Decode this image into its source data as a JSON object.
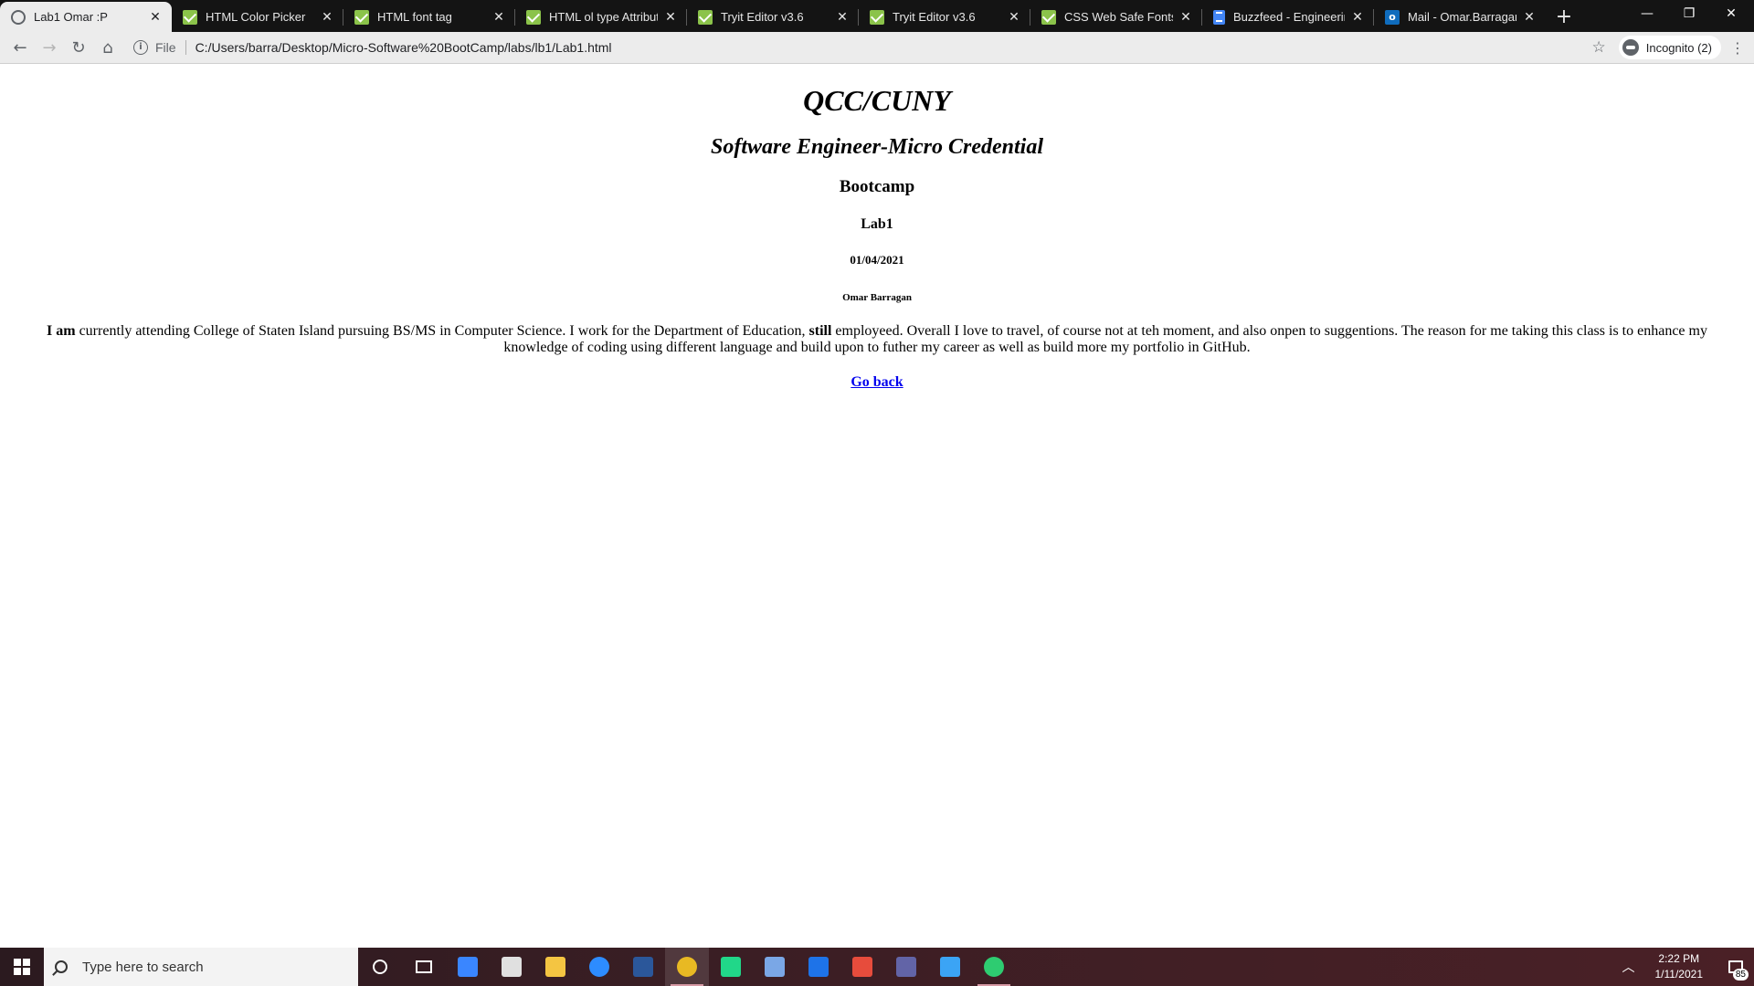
{
  "browser": {
    "tabs": [
      {
        "title": "Lab1 Omar :P",
        "icon": "globe-icon",
        "active": true
      },
      {
        "title": "HTML Color Picker",
        "icon": "w3schools-icon"
      },
      {
        "title": "HTML font tag",
        "icon": "w3schools-icon"
      },
      {
        "title": "HTML ol type Attribute",
        "icon": "w3schools-icon"
      },
      {
        "title": "Tryit Editor v3.6",
        "icon": "w3schools-icon"
      },
      {
        "title": "Tryit Editor v3.6",
        "icon": "w3schools-icon"
      },
      {
        "title": "CSS Web Safe Fonts",
        "icon": "w3schools-icon"
      },
      {
        "title": "Buzzfeed - Engineering",
        "icon": "google-docs-icon"
      },
      {
        "title": "Mail - Omar.Barragan@",
        "icon": "outlook-icon"
      }
    ],
    "new_tab": "+",
    "omnibox": {
      "scheme": "File",
      "url": "C:/Users/barra/Desktop/Micro-Software%20BootCamp/labs/lb1/Lab1.html"
    },
    "incognito_label": "Incognito (2)"
  },
  "page": {
    "h1": "QCC/CUNY",
    "h2": "Software Engineer-Micro Credential",
    "h3": "Bootcamp",
    "h4": "Lab1",
    "h5": "01/04/2021",
    "h6": "Omar Barragan",
    "paragraph": {
      "bold_start": "I am",
      "text_1": " currently attending College of Staten Island pursuing BS/MS in Computer Science. I work for the Department of Education, ",
      "bold_mid": "still",
      "text_2": " employeed. Overall I love to travel, of course not at teh moment, and also onpen to suggentions. The reason for me taking this class is to enhance my knowledge of coding using different language and build upon to futher my career as well as build more my portfolio in GitHub."
    },
    "back_link": "Go back"
  },
  "taskbar": {
    "search_placeholder": "Type here to search",
    "time": "2:22 PM",
    "date": "1/11/2021",
    "notification_count": "85",
    "pinned": [
      {
        "name": "calendar-icon",
        "color": "#3a86ff"
      },
      {
        "name": "store-icon",
        "color": "#e0e0e0"
      },
      {
        "name": "file-explorer-icon",
        "color": "#f4c542"
      },
      {
        "name": "zoom-icon",
        "color": "#2d8cff"
      },
      {
        "name": "word-icon",
        "color": "#2b579a"
      },
      {
        "name": "chrome-icon",
        "color": "#e8b923"
      },
      {
        "name": "pycharm-icon",
        "color": "#21d789"
      },
      {
        "name": "virtualbox-icon",
        "color": "#7aa7e6"
      },
      {
        "name": "app-w-icon",
        "color": "#1e73e8"
      },
      {
        "name": "office-icon",
        "color": "#e74c3c"
      },
      {
        "name": "teams-icon",
        "color": "#6264a7"
      },
      {
        "name": "phone-icon",
        "color": "#3ba4f5"
      },
      {
        "name": "app-green-icon",
        "color": "#2ecc71"
      }
    ]
  }
}
